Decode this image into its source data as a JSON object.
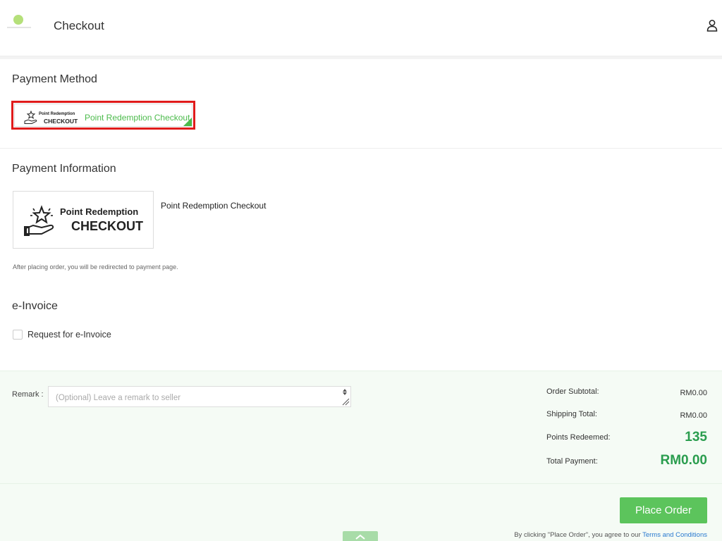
{
  "header": {
    "title": "Checkout",
    "logo_icon": "brand-logo",
    "user_icon": "user-icon"
  },
  "payment_method": {
    "title": "Payment Method",
    "selected": {
      "logo_line1": "Point Redemption",
      "logo_line2": "CHECKOUT",
      "label": "Point Redemption Checkout",
      "checked": true
    }
  },
  "payment_information": {
    "title": "Payment Information",
    "logo_line1": "Point Redemption",
    "logo_line2": "CHECKOUT",
    "caption": "Point Redemption Checkout",
    "note": "After placing order, you will be redirected to payment page."
  },
  "einvoice": {
    "title": "e-Invoice",
    "checkbox_label": "Request for e-Invoice",
    "checked": false
  },
  "remark": {
    "label": "Remark :",
    "placeholder": "(Optional) Leave a remark to seller",
    "value": ""
  },
  "summary": {
    "subtotal_label": "Order Subtotal:",
    "subtotal_value": "RM0.00",
    "shipping_label": "Shipping Total:",
    "shipping_value": "RM0.00",
    "points_label": "Points Redeemed:",
    "points_value": "135",
    "total_label": "Total Payment:",
    "total_value": "RM0.00"
  },
  "footer": {
    "place_order_label": "Place Order",
    "terms_prefix": "By clicking \"Place Order\", you agree to our ",
    "terms_link": "Terms and Conditions"
  },
  "colors": {
    "accent_green": "#5cc45c",
    "value_green": "#2a9d4e",
    "selected_border": "#e01b1b",
    "link_blue": "#2a7ad0"
  }
}
